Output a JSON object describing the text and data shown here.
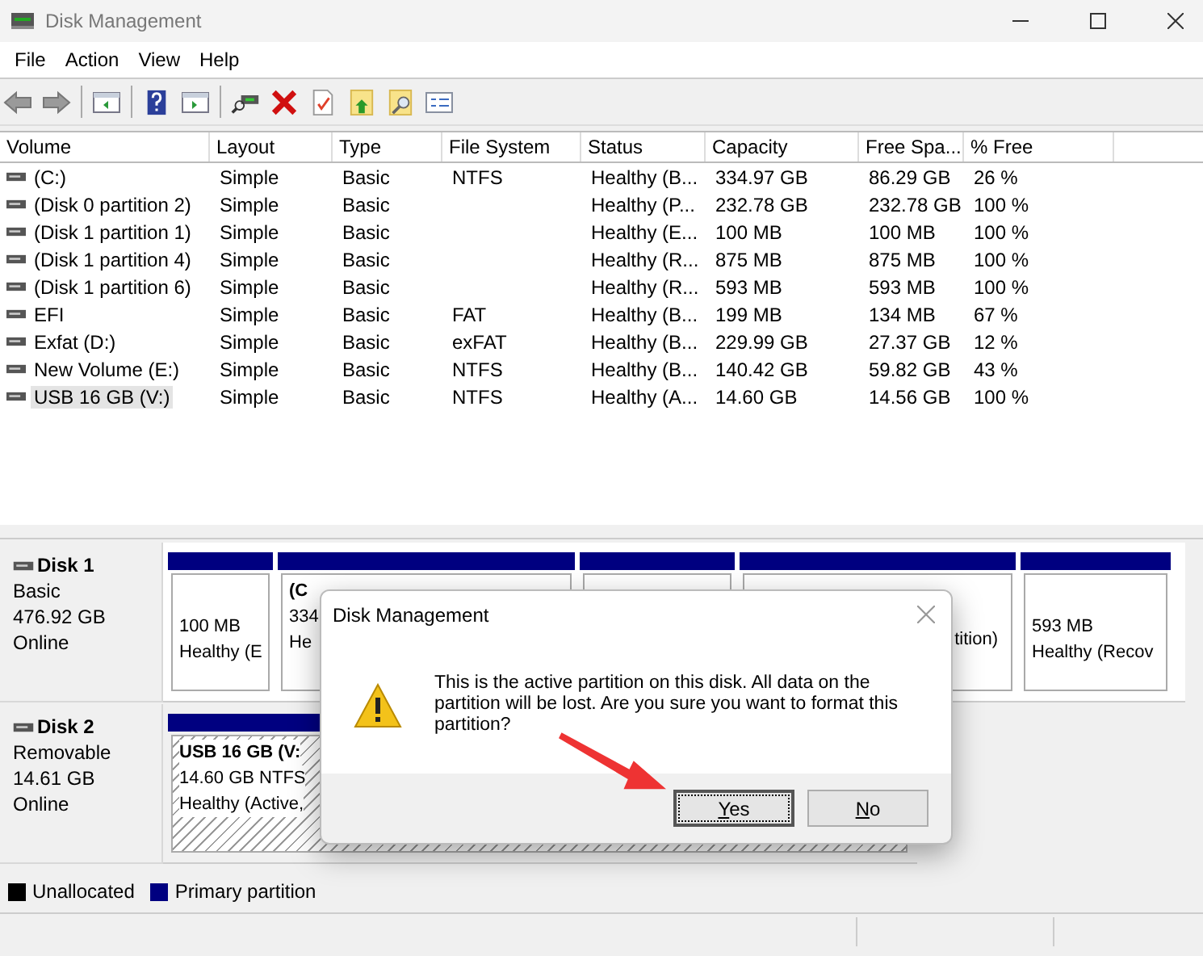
{
  "window": {
    "title": "Disk Management"
  },
  "menu": [
    "File",
    "Action",
    "View",
    "Help"
  ],
  "volumes": {
    "columns": [
      "Volume",
      "Layout",
      "Type",
      "File System",
      "Status",
      "Capacity",
      "Free Spa...",
      "% Free"
    ],
    "rows": [
      {
        "cells": [
          "(C:)",
          "Simple",
          "Basic",
          "NTFS",
          "Healthy (B...",
          "334.97 GB",
          "86.29 GB",
          "26 %"
        ],
        "selected": false
      },
      {
        "cells": [
          "(Disk 0 partition 2)",
          "Simple",
          "Basic",
          "",
          "Healthy (P...",
          "232.78 GB",
          "232.78 GB",
          "100 %"
        ],
        "selected": false
      },
      {
        "cells": [
          "(Disk 1 partition 1)",
          "Simple",
          "Basic",
          "",
          "Healthy (E...",
          "100 MB",
          "100 MB",
          "100 %"
        ],
        "selected": false
      },
      {
        "cells": [
          "(Disk 1 partition 4)",
          "Simple",
          "Basic",
          "",
          "Healthy (R...",
          "875 MB",
          "875 MB",
          "100 %"
        ],
        "selected": false
      },
      {
        "cells": [
          "(Disk 1 partition 6)",
          "Simple",
          "Basic",
          "",
          "Healthy (R...",
          "593 MB",
          "593 MB",
          "100 %"
        ],
        "selected": false
      },
      {
        "cells": [
          "EFI",
          "Simple",
          "Basic",
          "FAT",
          "Healthy (B...",
          "199 MB",
          "134 MB",
          "67 %"
        ],
        "selected": false
      },
      {
        "cells": [
          "Exfat (D:)",
          "Simple",
          "Basic",
          "exFAT",
          "Healthy (B...",
          "229.99 GB",
          "27.37 GB",
          "12 %"
        ],
        "selected": false
      },
      {
        "cells": [
          "New Volume (E:)",
          "Simple",
          "Basic",
          "NTFS",
          "Healthy (B...",
          "140.42 GB",
          "59.82 GB",
          "43 %"
        ],
        "selected": false
      },
      {
        "cells": [
          "USB 16 GB (V:)",
          "Simple",
          "Basic",
          "NTFS",
          "Healthy (A...",
          "14.60 GB",
          "14.56 GB",
          "100 %"
        ],
        "selected": true
      }
    ]
  },
  "disks": [
    {
      "name": "Disk 1",
      "type": "Basic",
      "size": "476.92 GB",
      "status": "Online",
      "partitions": [
        {
          "lines": [
            "100 MB",
            "Healthy (E"
          ],
          "selected": false
        },
        {
          "name": "(C",
          "lines": [
            "334",
            "He"
          ],
          "selected": false
        },
        {
          "selected": false
        },
        {
          "lines": [
            "tition)"
          ],
          "selected": false
        },
        {
          "lines": [
            "593 MB",
            "Healthy (Recov"
          ],
          "selected": false
        }
      ]
    },
    {
      "name": "Disk 2",
      "type": "Removable",
      "size": "14.61 GB",
      "status": "Online",
      "partitions": [
        {
          "name": "USB 16 GB  (V:",
          "lines": [
            "14.60 GB NTFS",
            "Healthy (Active,"
          ],
          "selected": true
        }
      ]
    }
  ],
  "legend": [
    {
      "label": "Unallocated",
      "color": "#000000"
    },
    {
      "label": "Primary partition",
      "color": "#000080"
    }
  ],
  "dialog": {
    "title": "Disk Management",
    "message": "This is the active partition on this disk. All data on the partition will be lost. Are you sure you want to format this partition?",
    "buttons": [
      {
        "label": "Yes",
        "default": true
      },
      {
        "label": "No",
        "default": false
      }
    ]
  }
}
